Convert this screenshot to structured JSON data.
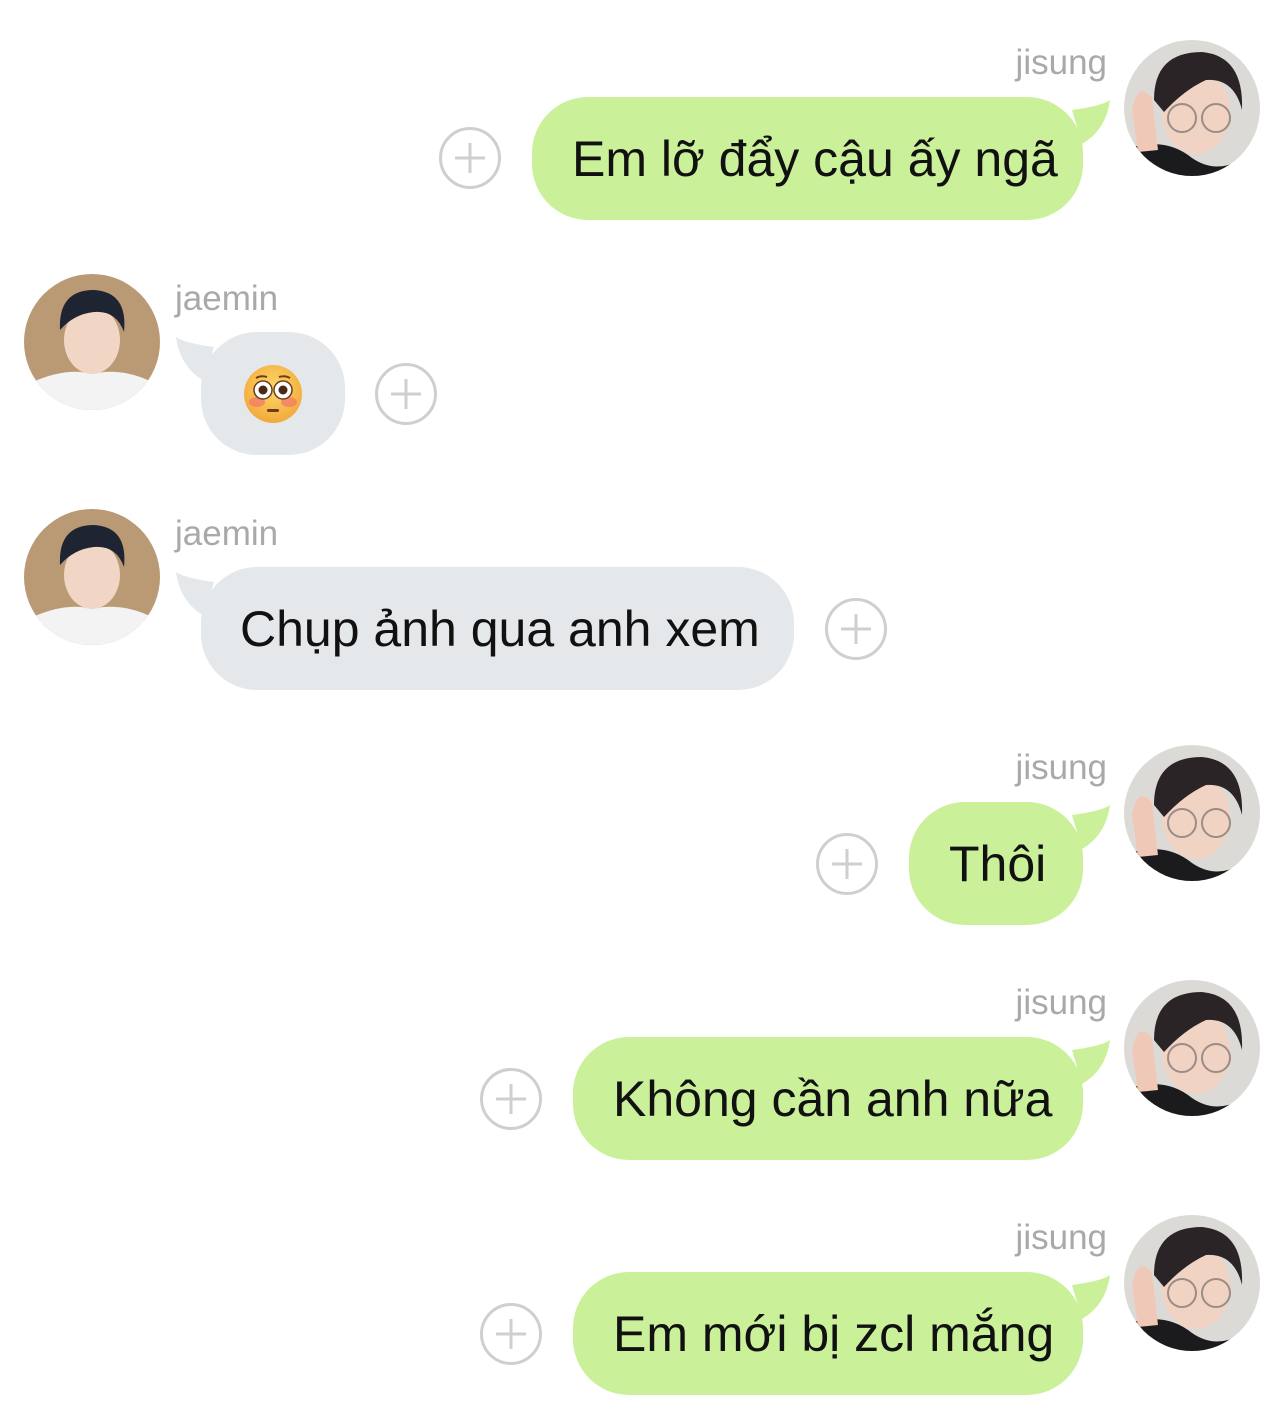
{
  "messages": [
    {
      "sender": "jisung",
      "text": "Em lỡ đẩy cậu ấy ngã"
    },
    {
      "sender": "jaemin",
      "emoji": "flushed-face-emoji"
    },
    {
      "sender": "jaemin",
      "text": "Chụp ảnh qua anh xem"
    },
    {
      "sender": "jisung",
      "text": "Thôi"
    },
    {
      "sender": "jisung",
      "text": "Không cần anh nữa"
    },
    {
      "sender": "jisung",
      "text": "Em mới bị zcl mắng"
    }
  ],
  "colors": {
    "outgoing_bubble": "#cbf09a",
    "incoming_bubble": "#e5e8eb",
    "sender_name": "#a9a9a9",
    "add_button_stroke": "#cfcfcf"
  },
  "icons": {
    "add": "plus-circle-icon"
  }
}
